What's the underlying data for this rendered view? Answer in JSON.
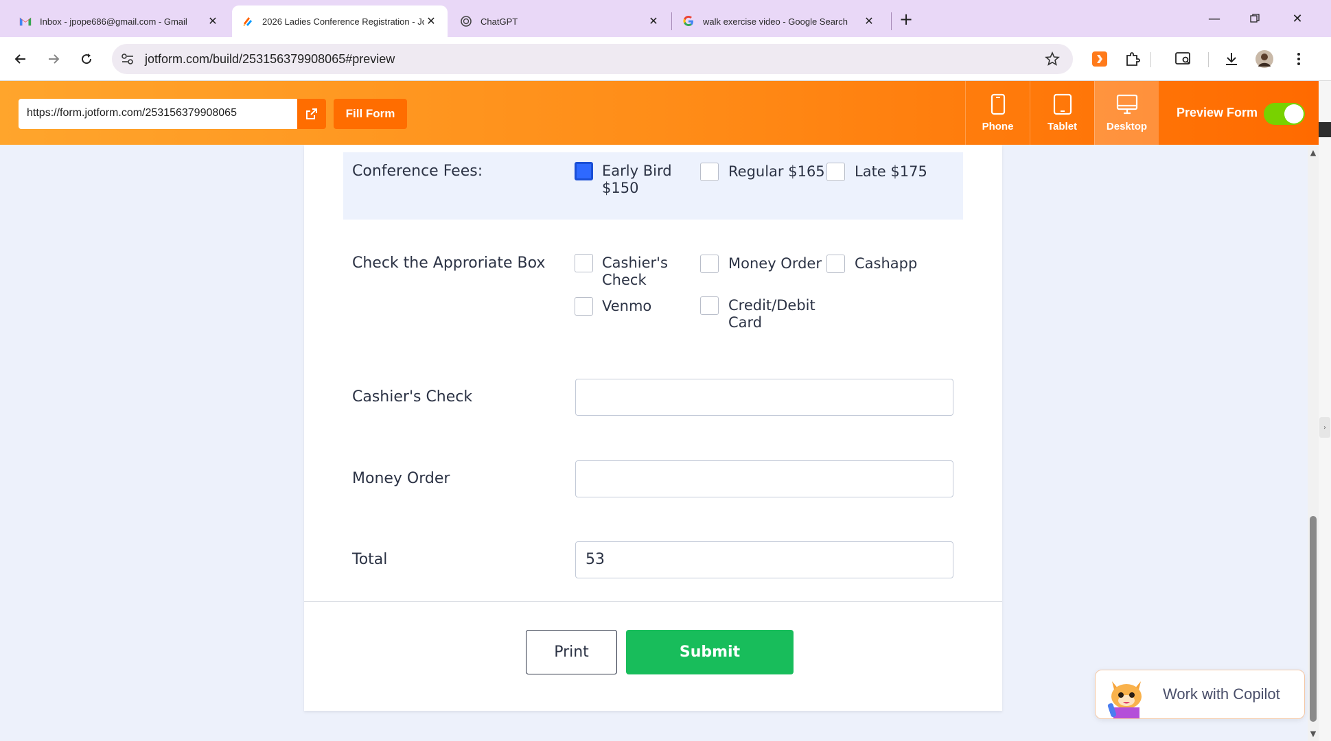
{
  "browser": {
    "tabs": [
      {
        "title": "Inbox - jpope686@gmail.com - Gmail",
        "icon": "gmail-icon"
      },
      {
        "title": "2026 Ladies Conference Registration - Jot",
        "icon": "jotform-icon",
        "active": true
      },
      {
        "title": "ChatGPT",
        "icon": "chatgpt-icon"
      },
      {
        "title": "walk exercise video - Google Search",
        "icon": "google-icon"
      }
    ],
    "address": "jotform.com/build/253156379908065#preview"
  },
  "jotform_bar": {
    "form_url": "https://form.jotform.com/253156379908065",
    "fill_form_label": "Fill Form",
    "devices": [
      {
        "label": "Phone",
        "icon": "phone-icon"
      },
      {
        "label": "Tablet",
        "icon": "tablet-icon"
      },
      {
        "label": "Desktop",
        "icon": "desktop-icon",
        "selected": true
      }
    ],
    "preview_label": "Preview Form",
    "preview_on": true,
    "accent": "#ff6d00"
  },
  "form": {
    "fees": {
      "label": "Conference Fees:",
      "options": [
        {
          "line1": "Early Bird",
          "line2": "$150",
          "checked": true
        },
        {
          "line1": "Regular $165",
          "line2": "",
          "checked": false
        },
        {
          "line1": "Late $175",
          "line2": "",
          "checked": false
        }
      ]
    },
    "payment": {
      "label": "Check the Approriate Box",
      "options": [
        {
          "line1": "Cashier's",
          "line2": "Check",
          "checked": false
        },
        {
          "line1": "Money Order",
          "line2": "",
          "checked": false
        },
        {
          "line1": "Cashapp",
          "line2": "",
          "checked": false
        },
        {
          "line1": "Venmo",
          "line2": "",
          "checked": false
        },
        {
          "line1": "Credit/Debit",
          "line2": "Card",
          "checked": false
        }
      ]
    },
    "cashiers_check": {
      "label": "Cashier's Check",
      "value": ""
    },
    "money_order": {
      "label": "Money Order",
      "value": ""
    },
    "total": {
      "label": "Total",
      "value": "53"
    },
    "print_label": "Print",
    "submit_label": "Submit",
    "submit_color": "#18bd5b"
  },
  "copilot": {
    "label": "Work with Copilot"
  }
}
